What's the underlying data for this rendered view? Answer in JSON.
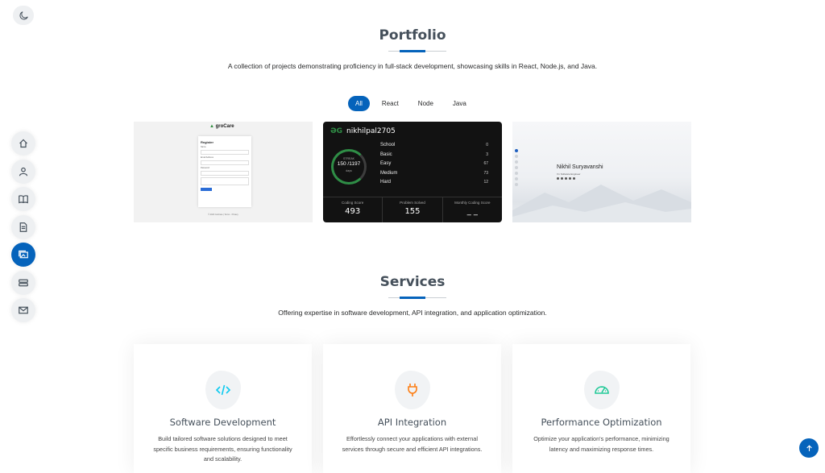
{
  "nav": {
    "items": [
      {
        "name": "home",
        "icon": "house-icon"
      },
      {
        "name": "about",
        "icon": "person-icon"
      },
      {
        "name": "resume",
        "icon": "book-icon"
      },
      {
        "name": "skills",
        "icon": "file-icon"
      },
      {
        "name": "portfolio",
        "icon": "images-icon",
        "active": true
      },
      {
        "name": "services",
        "icon": "server-icon"
      },
      {
        "name": "contact",
        "icon": "envelope-icon"
      }
    ]
  },
  "theme_toggle": {
    "icon": "moon-icon"
  },
  "portfolio": {
    "title": "Portfolio",
    "description": "A collection of projects demonstrating proficiency in full-stack development, showcasing skills in React, Node.js, and Java.",
    "filters": [
      {
        "label": "All",
        "active": true
      },
      {
        "label": "React"
      },
      {
        "label": "Node"
      },
      {
        "label": "Java"
      }
    ],
    "grocare": {
      "logo": "groCare",
      "form_title": "Register",
      "fields": [
        "Name",
        "Enter your name",
        "Email Address",
        "Enter email",
        "Password",
        "Password"
      ],
      "button": "Register",
      "footer": "© 2023 GroCare | Terms · Privacy"
    },
    "gfg": {
      "username": "nikhilpal2705",
      "streak_label": "STREAK",
      "streak_value": "150 /1197",
      "streak_unit": "days",
      "stats": [
        {
          "label": "School",
          "value": "0"
        },
        {
          "label": "Basic",
          "value": "3"
        },
        {
          "label": "Easy",
          "value": "67"
        },
        {
          "label": "Medium",
          "value": "73"
        },
        {
          "label": "Hard",
          "value": "12"
        }
      ],
      "bottom": [
        {
          "label": "Coding Score",
          "value": "493"
        },
        {
          "label": "Problem Solved",
          "value": "155"
        },
        {
          "label": "Monthly Coding Score",
          "value": "_ _"
        }
      ]
    },
    "personal_site": {
      "name": "Nikhil Suryavanshi",
      "subtitle": "I'm Software Engineer"
    }
  },
  "services": {
    "title": "Services",
    "description": "Offering expertise in software development, API integration, and application optimization.",
    "cards": [
      {
        "title": "Software Development",
        "icon": "code-icon",
        "icon_color": "#0dcaf0",
        "description": "Build tailored software solutions designed to meet specific business requirements, ensuring functionality and scalability."
      },
      {
        "title": "API Integration",
        "icon": "plug-icon",
        "icon_color": "#fd7e14",
        "description": "Effortlessly connect your applications with external services through secure and efficient API integrations."
      },
      {
        "title": "Performance Optimization",
        "icon": "speedometer-icon",
        "icon_color": "#20c997",
        "description": "Optimize your application's performance, minimizing latency and maximizing response times."
      }
    ]
  },
  "accent_color": "#0563bb",
  "back_to_top": {
    "icon": "arrow-up-icon"
  }
}
